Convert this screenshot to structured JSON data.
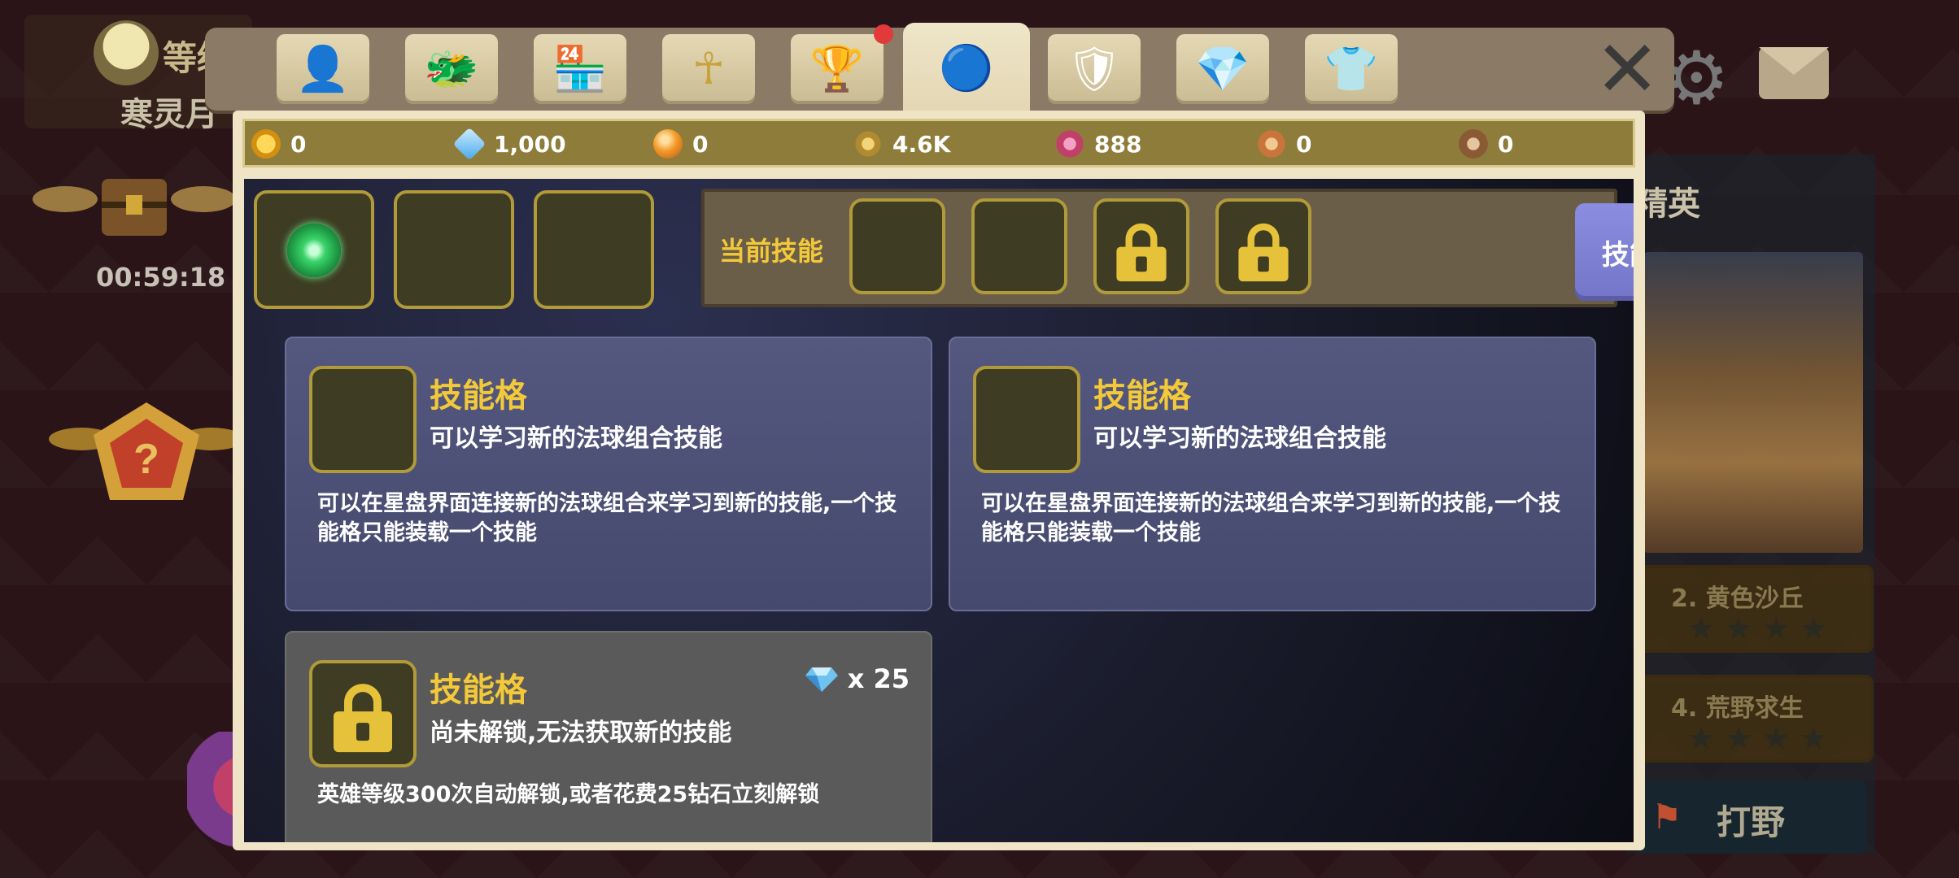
{
  "background": {
    "player_level_label": "等级",
    "player_name": "寒灵月",
    "chest_timer": "00:59:18",
    "right_panel_title": "精英",
    "stages": [
      {
        "title": "2. 黄色沙丘",
        "stars": "★★★★"
      },
      {
        "title": "4. 荒野求生",
        "stars": "★★★★"
      }
    ],
    "hunt_button": "打野"
  },
  "tabs": [
    {
      "name": "tab-profile",
      "icon": "person-icon",
      "glyph": "👤"
    },
    {
      "name": "tab-hero",
      "icon": "horned-helmet-icon",
      "glyph": "🐲"
    },
    {
      "name": "tab-shop",
      "icon": "shop-icon",
      "glyph": "🏪"
    },
    {
      "name": "tab-ankh",
      "icon": "ankh-icon",
      "glyph": "☥"
    },
    {
      "name": "tab-trophy",
      "icon": "trophy-icon",
      "glyph": "🏆"
    },
    {
      "name": "tab-orb",
      "icon": "orb-icon",
      "glyph": "🔵"
    },
    {
      "name": "tab-armor",
      "icon": "armor-icon",
      "glyph": "🛡"
    },
    {
      "name": "tab-gem",
      "icon": "gem-icon",
      "glyph": "💎"
    },
    {
      "name": "tab-outfit",
      "icon": "shirt-icon",
      "glyph": "👕"
    }
  ],
  "close_glyph": "✕",
  "currencies": [
    {
      "name": "gold",
      "icon": "gold-coin-icon",
      "value": "0",
      "color": "#e8b323"
    },
    {
      "name": "diamond",
      "icon": "diamond-icon",
      "value": "1,000",
      "color": "#6fc3f0"
    },
    {
      "name": "orb",
      "icon": "orange-orb-icon",
      "value": "0",
      "color": "#f0962a"
    },
    {
      "name": "star-dust",
      "icon": "dust-icon",
      "value": "4.6K",
      "color": "#d8b55a"
    },
    {
      "name": "pink-gem",
      "icon": "pink-gem-icon",
      "value": "888",
      "color": "#d86a9a"
    },
    {
      "name": "fox",
      "icon": "fox-icon",
      "value": "0",
      "color": "#c8743a"
    },
    {
      "name": "bear",
      "icon": "bear-icon",
      "value": "0",
      "color": "#9a6a44"
    }
  ],
  "current_skills_label": "当前技能",
  "skill_tree_button": "技能/星图",
  "cards": [
    {
      "title": "技能格",
      "subtitle": "可以学习新的法球组合技能",
      "description": "可以在星盘界面连接新的法球组合来学习到新的技能,一个技能格只能装载一个技能"
    },
    {
      "title": "技能格",
      "subtitle": "可以学习新的法球组合技能",
      "description": "可以在星盘界面连接新的法球组合来学习到新的技能,一个技能格只能装载一个技能"
    },
    {
      "title": "技能格",
      "subtitle": "尚未解锁,无法获取新的技能",
      "description": "英雄等级300次自动解锁,或者花费25钻石立刻解锁",
      "cost": "x 25"
    }
  ],
  "colors": {
    "accent_gold": "#f3c93a",
    "skill_tree_button": "#7d80d6"
  }
}
